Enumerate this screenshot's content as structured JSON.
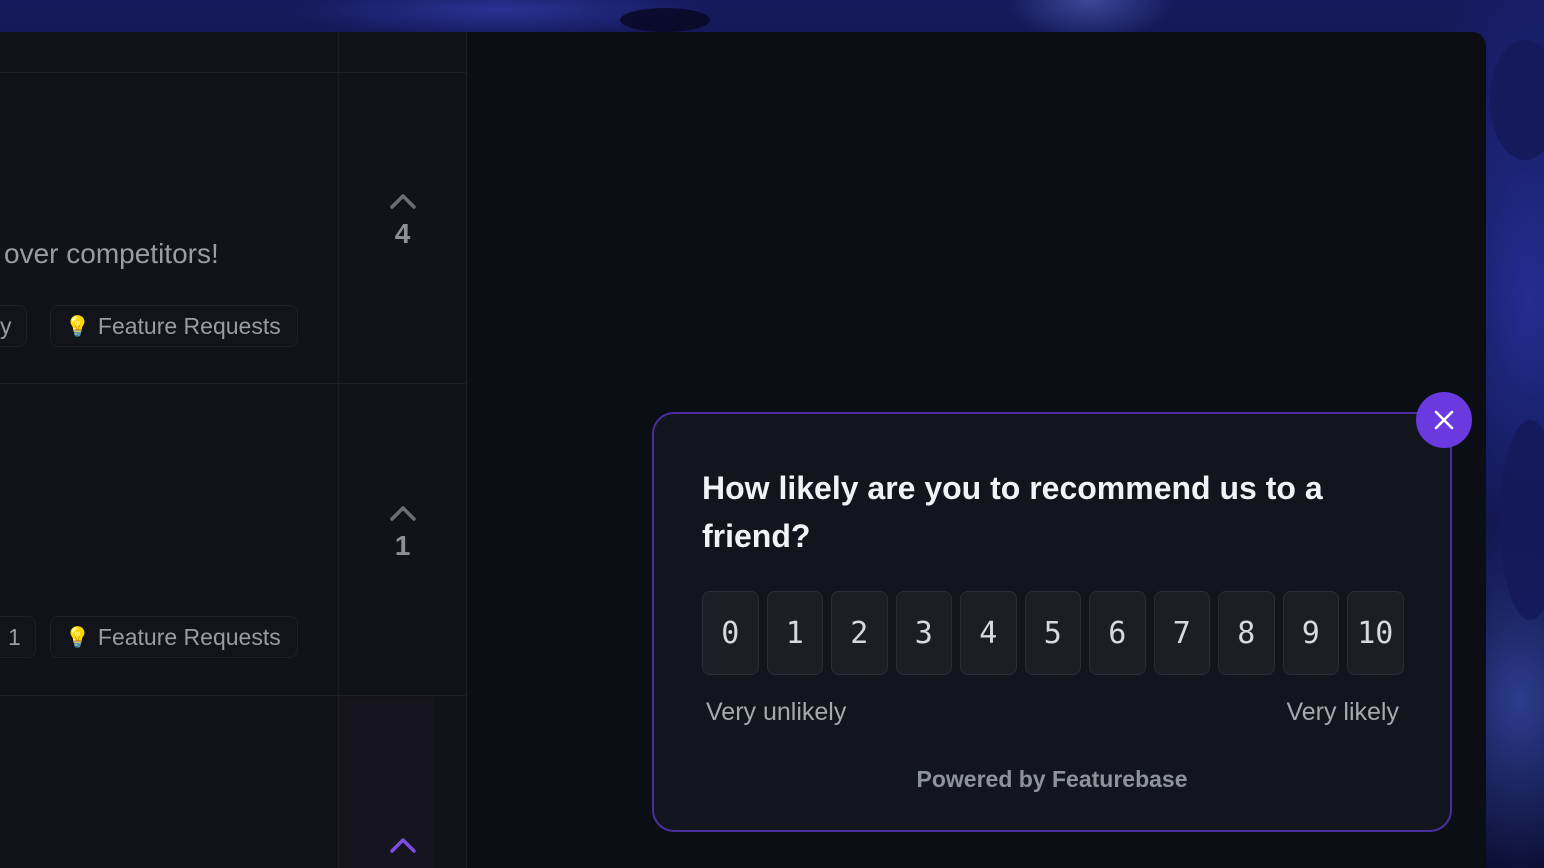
{
  "feed": {
    "posts": [
      {
        "title_fragment": "over competitors!",
        "tags": [
          {
            "label_fragment": "y"
          },
          {
            "icon": "lightbulb-icon",
            "label": "Feature Requests"
          }
        ],
        "votes": "4"
      },
      {
        "title_fragment": "",
        "tags": [
          {
            "label_fragment": "1"
          },
          {
            "icon": "lightbulb-icon",
            "label": "Feature Requests"
          }
        ],
        "votes": "1"
      }
    ],
    "third_post_upvote_color": "#7c4ddf"
  },
  "survey": {
    "question": "How likely are you to recommend us to a friend?",
    "scale": [
      "0",
      "1",
      "2",
      "3",
      "4",
      "5",
      "6",
      "7",
      "8",
      "9",
      "10"
    ],
    "min_label": "Very unlikely",
    "max_label": "Very likely",
    "powered_by": "Powered by Featurebase",
    "close_icon": "close-icon",
    "accent_color": "#6a3ae0"
  }
}
